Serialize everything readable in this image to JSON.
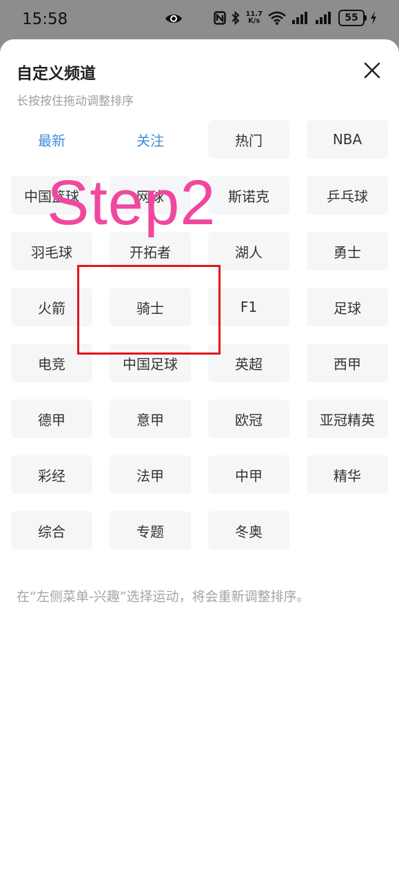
{
  "status_bar": {
    "time": "15:58",
    "net_speed_value": "11.7",
    "net_speed_unit": "K/s",
    "battery": "55"
  },
  "sheet": {
    "title": "自定义频道",
    "subtitle": "长按按住拖动调整排序",
    "fixed_channels": [
      "最新",
      "关注"
    ],
    "channels": [
      "热门",
      "NBA",
      "中国篮球",
      "网球",
      "斯诺克",
      "乒乓球",
      "羽毛球",
      "开拓者",
      "湖人",
      "勇士",
      "火箭",
      "骑士",
      "F1",
      "足球",
      "电竞",
      "中国足球",
      "英超",
      "西甲",
      "德甲",
      "意甲",
      "欧冠",
      "亚冠精英",
      "彩经",
      "法甲",
      "中甲",
      "精华",
      "综合",
      "专题",
      "冬奥"
    ],
    "footnote": "在“左侧菜单-兴趣”选择运动，将会重新调整排序。"
  },
  "annotation": {
    "step_label": "Step2",
    "step_color": "#f0489e",
    "highlight_color": "#e0161b",
    "highlighted_channel": "骑士"
  }
}
